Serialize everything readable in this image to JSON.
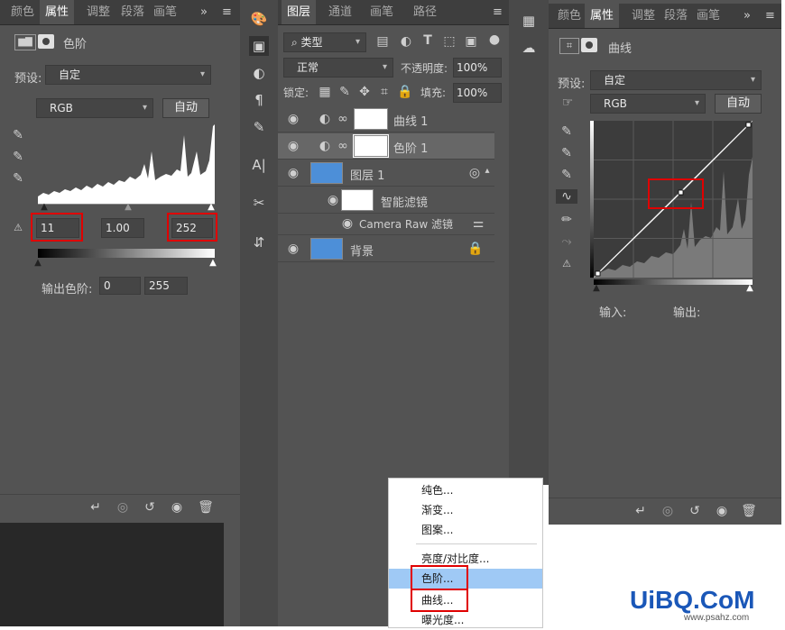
{
  "levels_panel": {
    "tabs": [
      "颜色",
      "属性",
      "调整",
      "段落",
      "画笔设"
    ],
    "active_tab": "属性",
    "panel_title": "色阶",
    "preset_label": "预设:",
    "preset_value": "自定",
    "channel": "RGB",
    "auto_button": "自动",
    "input_black": "11",
    "input_gamma": "1.00",
    "input_white": "252",
    "output_label": "输出色阶:",
    "output_black": "0",
    "output_white": "255"
  },
  "layers_panel": {
    "tabs": [
      "图层",
      "通道",
      "画笔",
      "路径"
    ],
    "active_tab": "图层",
    "filter_label": "类型",
    "blend_mode": "正常",
    "opacity_label": "不透明度:",
    "opacity_value": "100%",
    "lock_label": "锁定:",
    "fill_label": "填充:",
    "fill_value": "100%",
    "layers": [
      {
        "name": "曲线 1"
      },
      {
        "name": "色阶 1"
      },
      {
        "name": "图层 1"
      },
      {
        "name": "智能滤镜"
      },
      {
        "name": "Camera Raw 滤镜"
      },
      {
        "name": "背景"
      }
    ]
  },
  "adjust_menu": {
    "items": [
      "纯色...",
      "渐变...",
      "图案...",
      "亮度/对比度...",
      "色阶...",
      "曲线...",
      "曝光度..."
    ],
    "highlighted": "色阶..."
  },
  "curves_panel": {
    "tabs": [
      "颜色",
      "属性",
      "调整",
      "段落",
      "画笔设"
    ],
    "active_tab": "属性",
    "panel_title": "曲线",
    "preset_label": "预设:",
    "preset_value": "自定",
    "channel": "RGB",
    "auto_button": "自动",
    "input_label": "输入:",
    "output_label": "输出:"
  },
  "watermark": {
    "brand": "UiBQ.CoM",
    "url": "www.psahz.com"
  },
  "colors": {
    "panel_bg": "#535353",
    "tab_bg": "#3e3e3e",
    "highlight_red": "#e00000",
    "menu_highlight": "#9fc9f5",
    "watermark_blue": "#1a57b8"
  }
}
